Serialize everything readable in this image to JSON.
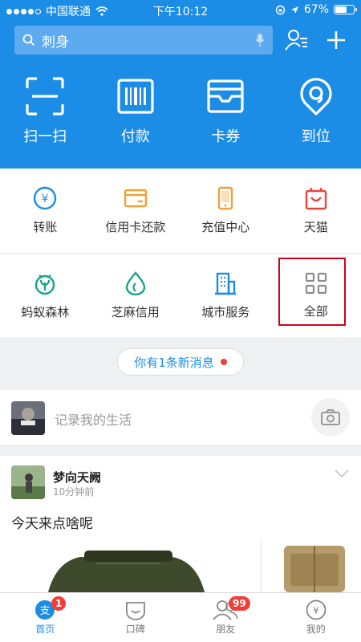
{
  "status_bar": {
    "carrier": "中国联通",
    "time": "下午10:12",
    "battery_percent": "67%",
    "battery_level": 0.67
  },
  "search": {
    "placeholder": "刺身"
  },
  "quick_actions": [
    {
      "label": "扫一扫",
      "icon": "scan-icon"
    },
    {
      "label": "付款",
      "icon": "barcode-icon"
    },
    {
      "label": "卡券",
      "icon": "card-wallet-icon"
    },
    {
      "label": "到位",
      "icon": "location-pin-icon"
    }
  ],
  "services": {
    "row1": [
      {
        "label": "转账",
        "icon": "transfer-icon"
      },
      {
        "label": "信用卡还款",
        "icon": "credit-card-icon"
      },
      {
        "label": "充值中心",
        "icon": "phone-recharge-icon"
      },
      {
        "label": "天猫",
        "icon": "tmall-icon"
      }
    ],
    "row2": [
      {
        "label": "蚂蚁森林",
        "icon": "ant-forest-icon"
      },
      {
        "label": "芝麻信用",
        "icon": "sesame-credit-icon"
      },
      {
        "label": "城市服务",
        "icon": "city-service-icon"
      },
      {
        "label": "全部",
        "icon": "grid-all-icon"
      }
    ]
  },
  "message_pill": {
    "text": "你有1条新消息"
  },
  "post_input": {
    "placeholder": "记录我的生活"
  },
  "feed": {
    "author": "梦向天阙",
    "time": "10分钟前",
    "content": "今天来点啥呢"
  },
  "tabs": [
    {
      "label": "首页",
      "icon": "home-pay-icon",
      "badge": "1",
      "active": true
    },
    {
      "label": "口碑",
      "icon": "koubei-icon",
      "badge": "",
      "active": false
    },
    {
      "label": "朋友",
      "icon": "friends-icon",
      "badge": "99",
      "active": false
    },
    {
      "label": "我的",
      "icon": "my-wallet-icon",
      "badge": "",
      "active": false
    }
  ],
  "colors": {
    "brand_blue": "#1c8de6",
    "badge_red": "#f23d3d",
    "highlight_red": "#d0021b"
  }
}
